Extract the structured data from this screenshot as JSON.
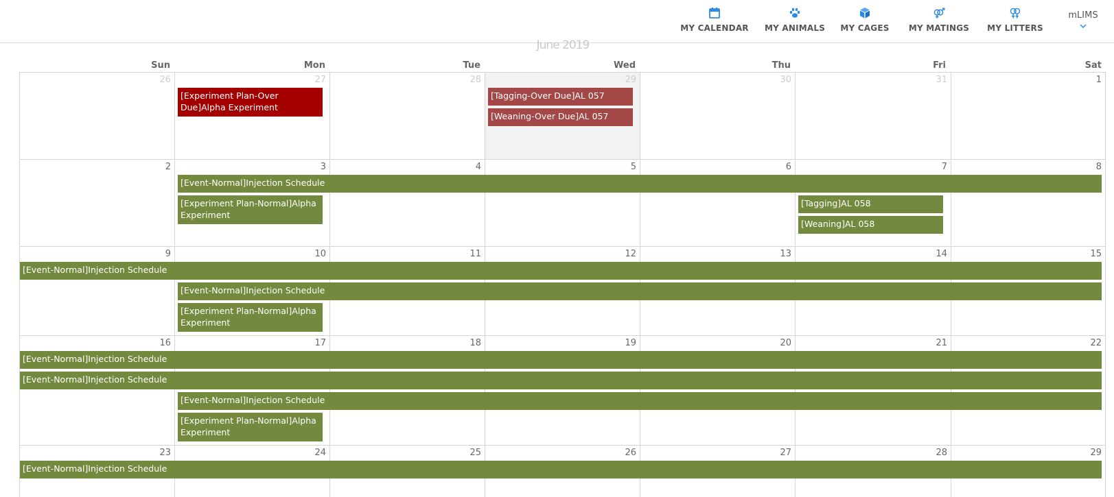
{
  "nav": {
    "items": [
      {
        "label": "MY CALENDAR",
        "icon": "calendar-icon"
      },
      {
        "label": "MY ANIMALS",
        "icon": "paw-icon"
      },
      {
        "label": "MY CAGES",
        "icon": "cube-icon"
      },
      {
        "label": "MY MATINGS",
        "icon": "venus-mars-icon"
      },
      {
        "label": "MY LITTERS",
        "icon": "venus-double-icon"
      }
    ],
    "user": "mLIMS",
    "icon_color": "#2b8ae6"
  },
  "calendar": {
    "month_title": "June 2019",
    "weekdays": [
      "Sun",
      "Mon",
      "Tue",
      "Wed",
      "Thu",
      "Fri",
      "Sat"
    ],
    "weeks": [
      [
        "26",
        "27",
        "28",
        "29",
        "30",
        "31",
        "1"
      ],
      [
        "2",
        "3",
        "4",
        "5",
        "6",
        "7",
        "8"
      ],
      [
        "9",
        "10",
        "11",
        "12",
        "13",
        "14",
        "15"
      ],
      [
        "16",
        "17",
        "18",
        "19",
        "20",
        "21",
        "22"
      ],
      [
        "23",
        "24",
        "25",
        "26",
        "27",
        "28",
        "29"
      ]
    ],
    "events": {
      "w0_exp_plan": "[Experiment Plan-Over Due]Alpha Experiment",
      "w0_tagging": "[Tagging-Over Due]AL 057",
      "w0_weaning": "[Weaning-Over Due]AL 057",
      "w1_injection": "[Event-Normal]Injection Schedule",
      "w1_exp_plan": "[Experiment Plan-Normal]Alpha Experiment",
      "w1_tagging": "[Tagging]AL 058",
      "w1_weaning": "[Weaning]AL 058",
      "w2_injection_a": "[Event-Normal]Injection Schedule",
      "w2_injection_b": "[Event-Normal]Injection Schedule",
      "w2_exp_plan": "[Experiment Plan-Normal]Alpha Experiment",
      "w3_injection_a": "[Event-Normal]Injection Schedule",
      "w3_injection_b": "[Event-Normal]Injection Schedule",
      "w3_injection_c": "[Event-Normal]Injection Schedule",
      "w3_exp_plan": "[Experiment Plan-Normal]Alpha Experiment",
      "w4_injection": "[Event-Normal]Injection Schedule"
    },
    "colors": {
      "normal": "#73893e",
      "overdue_plan": "#a40000",
      "overdue_task": "#a44747",
      "today_bg": "#f2f2f2"
    }
  }
}
